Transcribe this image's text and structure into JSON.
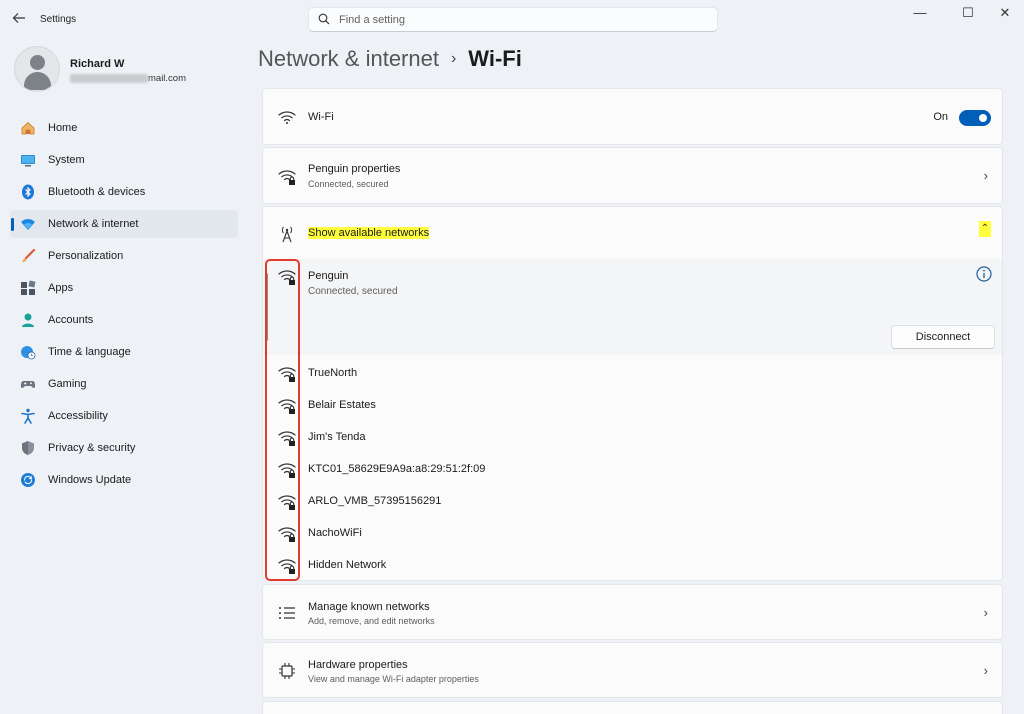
{
  "window": {
    "app_title": "Settings",
    "back_icon": "back-arrow-icon",
    "minimize_glyph": "—",
    "maximize_glyph": "☐",
    "close_glyph": "✕"
  },
  "search": {
    "placeholder": "Find a setting",
    "icon": "search-icon"
  },
  "user": {
    "name": "Richard W",
    "email_suffix": "mail.com"
  },
  "sidebar": {
    "items": [
      {
        "label": "Home",
        "icon": "home-icon"
      },
      {
        "label": "System",
        "icon": "system-icon"
      },
      {
        "label": "Bluetooth & devices",
        "icon": "bluetooth-icon"
      },
      {
        "label": "Network & internet",
        "icon": "network-icon",
        "active": true
      },
      {
        "label": "Personalization",
        "icon": "brush-icon"
      },
      {
        "label": "Apps",
        "icon": "apps-icon"
      },
      {
        "label": "Accounts",
        "icon": "accounts-icon"
      },
      {
        "label": "Time & language",
        "icon": "globe-clock-icon"
      },
      {
        "label": "Gaming",
        "icon": "gamepad-icon"
      },
      {
        "label": "Accessibility",
        "icon": "accessibility-icon"
      },
      {
        "label": "Privacy & security",
        "icon": "shield-icon"
      },
      {
        "label": "Windows Update",
        "icon": "update-icon"
      }
    ]
  },
  "breadcrumb": {
    "parent": "Network & internet",
    "separator": "›",
    "current": "Wi-Fi"
  },
  "wifi_card": {
    "label": "Wi-Fi",
    "state_label": "On",
    "enabled": true
  },
  "properties_card": {
    "title": "Penguin properties",
    "subtitle": "Connected, secured"
  },
  "available": {
    "label": "Show available networks",
    "expanded": true
  },
  "connected_network": {
    "name": "Penguin",
    "status": "Connected, secured",
    "disconnect_label": "Disconnect"
  },
  "networks": [
    {
      "name": "TrueNorth",
      "icon": "wifi-lock-icon"
    },
    {
      "name": "Belair Estates",
      "icon": "wifi-lock-icon"
    },
    {
      "name": "Jim's Tenda",
      "icon": "wifi-lock-icon"
    },
    {
      "name": "KTC01_58629E9A9a:a8:29:51:2f:09",
      "icon": "wifi-lock-icon"
    },
    {
      "name": "ARLO_VMB_57395156291",
      "icon": "wifi-lock-icon"
    },
    {
      "name": "NachoWiFi",
      "icon": "wifi-lock-icon"
    },
    {
      "name": "Hidden Network",
      "icon": "wifi-lock-icon"
    }
  ],
  "manage_card": {
    "title": "Manage known networks",
    "subtitle": "Add, remove, and edit networks"
  },
  "hardware_card": {
    "title": "Hardware properties",
    "subtitle": "View and manage Wi-Fi adapter properties"
  },
  "colors": {
    "accent": "#005fb8",
    "highlight": "#ffff3c",
    "annotation_red": "#e23b2e"
  }
}
